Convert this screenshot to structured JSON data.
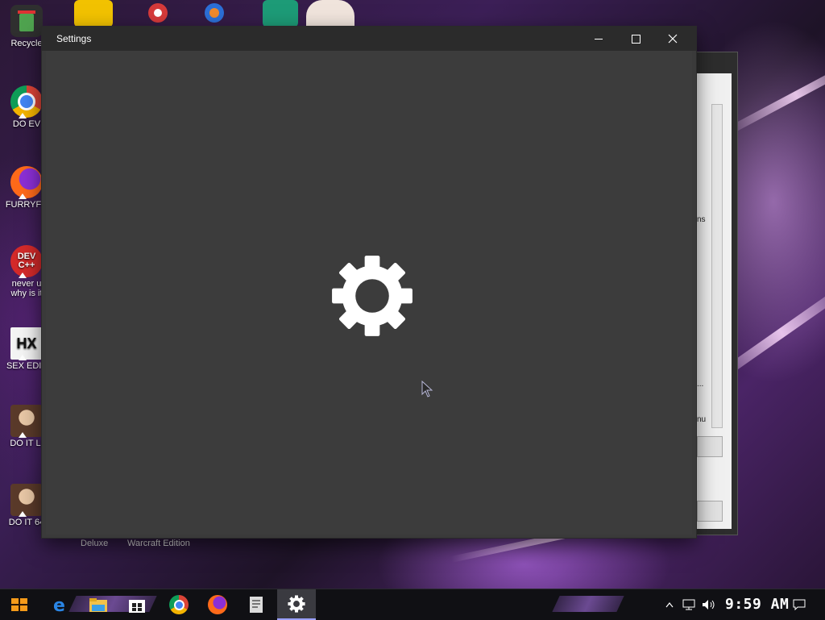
{
  "desktop": {
    "icons": [
      {
        "label": "Recycle",
        "color": "#3a3a3a"
      },
      {
        "label": "DO EV",
        "color": "#ffffff"
      },
      {
        "label": "FURRYFU",
        "color": "#ff6a1a"
      },
      {
        "label": "never u\nwhy is it",
        "color": "#d42a2a"
      },
      {
        "label": "SEX EDIT",
        "color": "#ffffff"
      },
      {
        "label": "DO IT LI",
        "color": "#c9a27a"
      },
      {
        "label": "DO IT 64",
        "color": "#c9a27a"
      }
    ],
    "dev_icon_text": "DEV\nC++",
    "hex_icon_text": "HX",
    "below_labels": [
      "Deluxe",
      "Warcraft Edition"
    ]
  },
  "settings_window": {
    "title": "Settings",
    "minimize_glyph": "",
    "maximize_glyph": "",
    "close_glyph": "",
    "splash_icon": "gear-icon"
  },
  "background_window": {
    "fragment_texts": [
      "ns",
      "...",
      "nu"
    ]
  },
  "taskbar": {
    "items": [
      "start-button",
      "edge-icon",
      "file-explorer-icon",
      "store-icon",
      "chrome-icon",
      "firefox-icon",
      "document-app-icon",
      "settings-icon"
    ],
    "active_item": "settings-icon",
    "clock": "9:59 AM",
    "tray": [
      "chevron-up-icon",
      "network-icon",
      "volume-icon",
      "action-center-icon"
    ]
  },
  "colors": {
    "window_bg": "#3a3a3a",
    "titlebar_bg": "#2b2b2b",
    "taskbar_bg": "#101014",
    "accent": "#9a7cd8"
  }
}
